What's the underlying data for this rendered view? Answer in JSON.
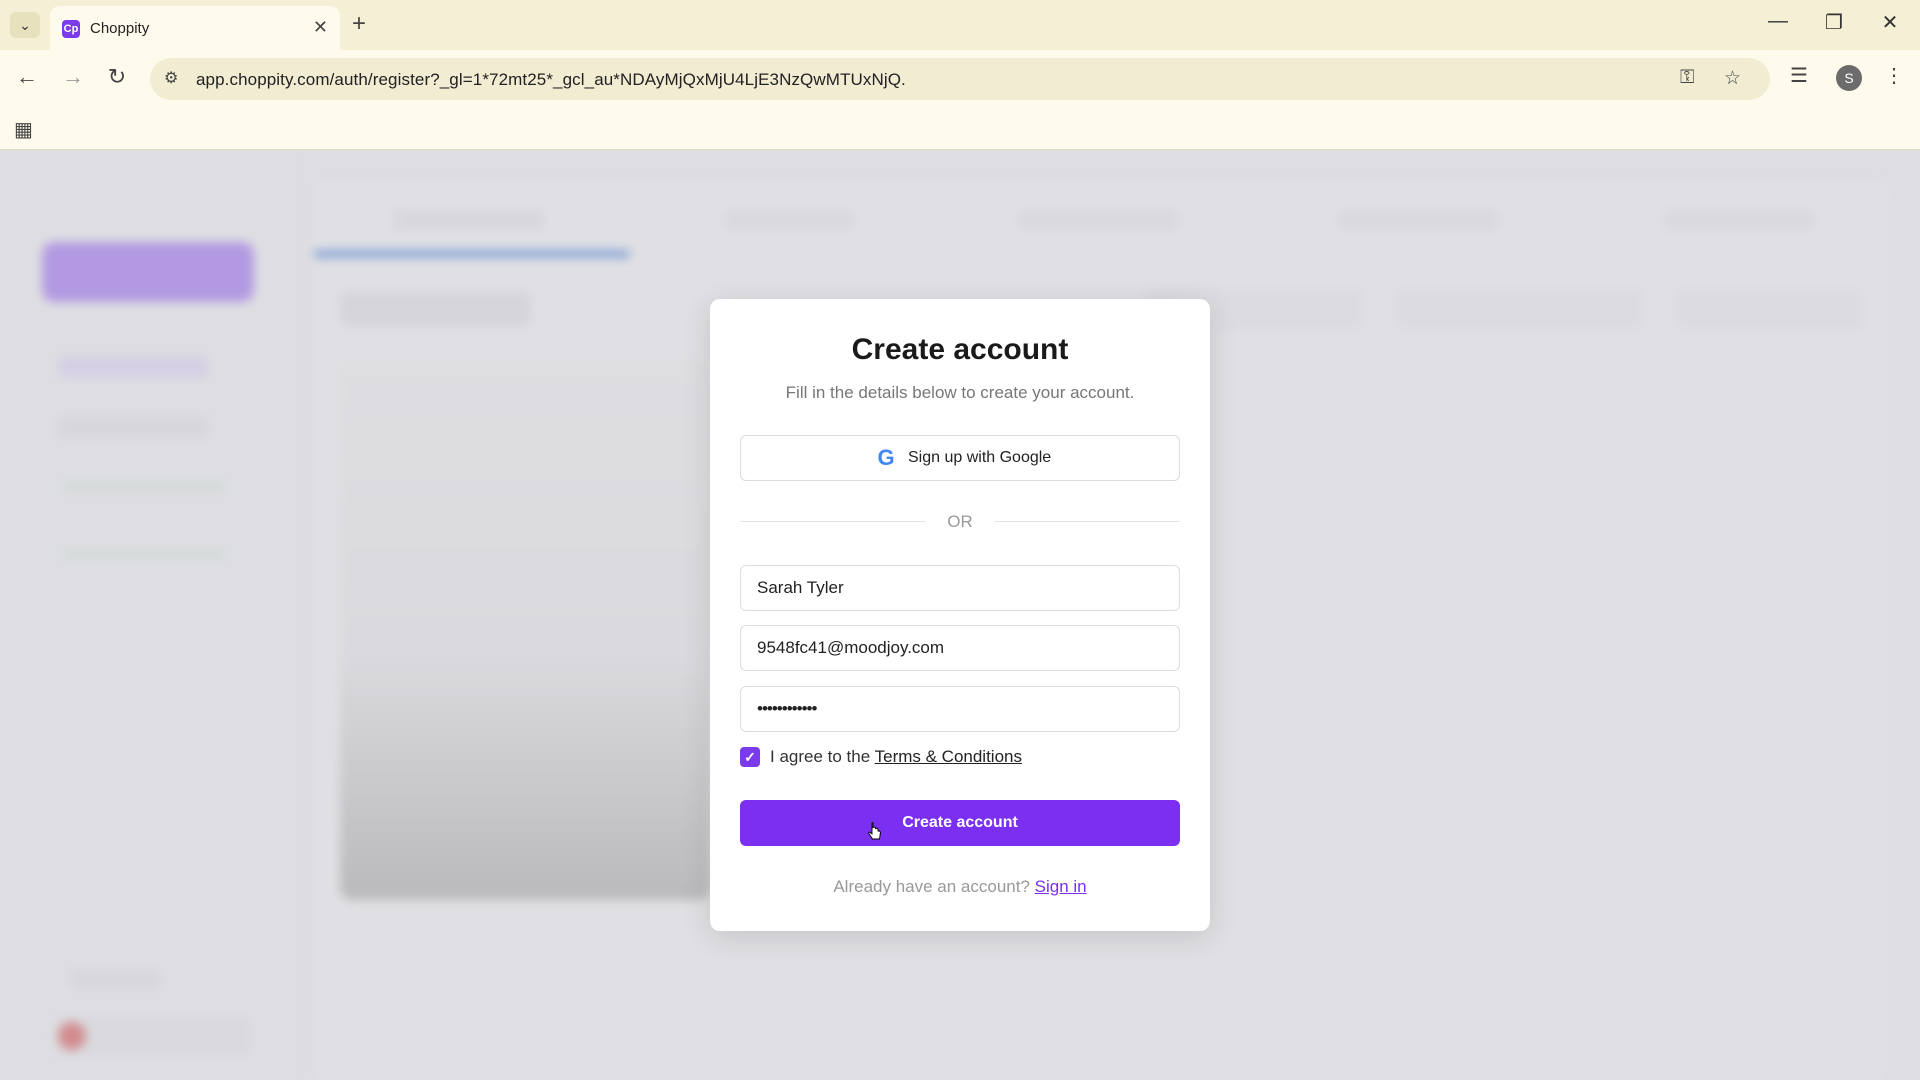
{
  "browser": {
    "tab_title": "Choppity",
    "tab_favicon": "Cp",
    "url": "app.choppity.com/auth/register?_gl=1*72mt25*_gcl_au*NDAyMjQxMjU4LjE3NzQwMTUxNjQ.",
    "profile_initial": "S"
  },
  "modal": {
    "title": "Create account",
    "subtitle": "Fill in the details below to create your account.",
    "google_label": "Sign up with Google",
    "divider": "OR",
    "name_value": "Sarah Tyler",
    "email_value": "9548fc41@moodjoy.com",
    "password_mask": "••••••••••••",
    "terms_prefix": "I agree to the ",
    "terms_link": "Terms & Conditions",
    "terms_checked": true,
    "create_label": "Create account",
    "signin_prefix": "Already have an account? ",
    "signin_link": "Sign in"
  },
  "colors": {
    "accent": "#7b2ff0",
    "tabstrip": "#f5f0d5",
    "toolbar": "#fffbec"
  }
}
